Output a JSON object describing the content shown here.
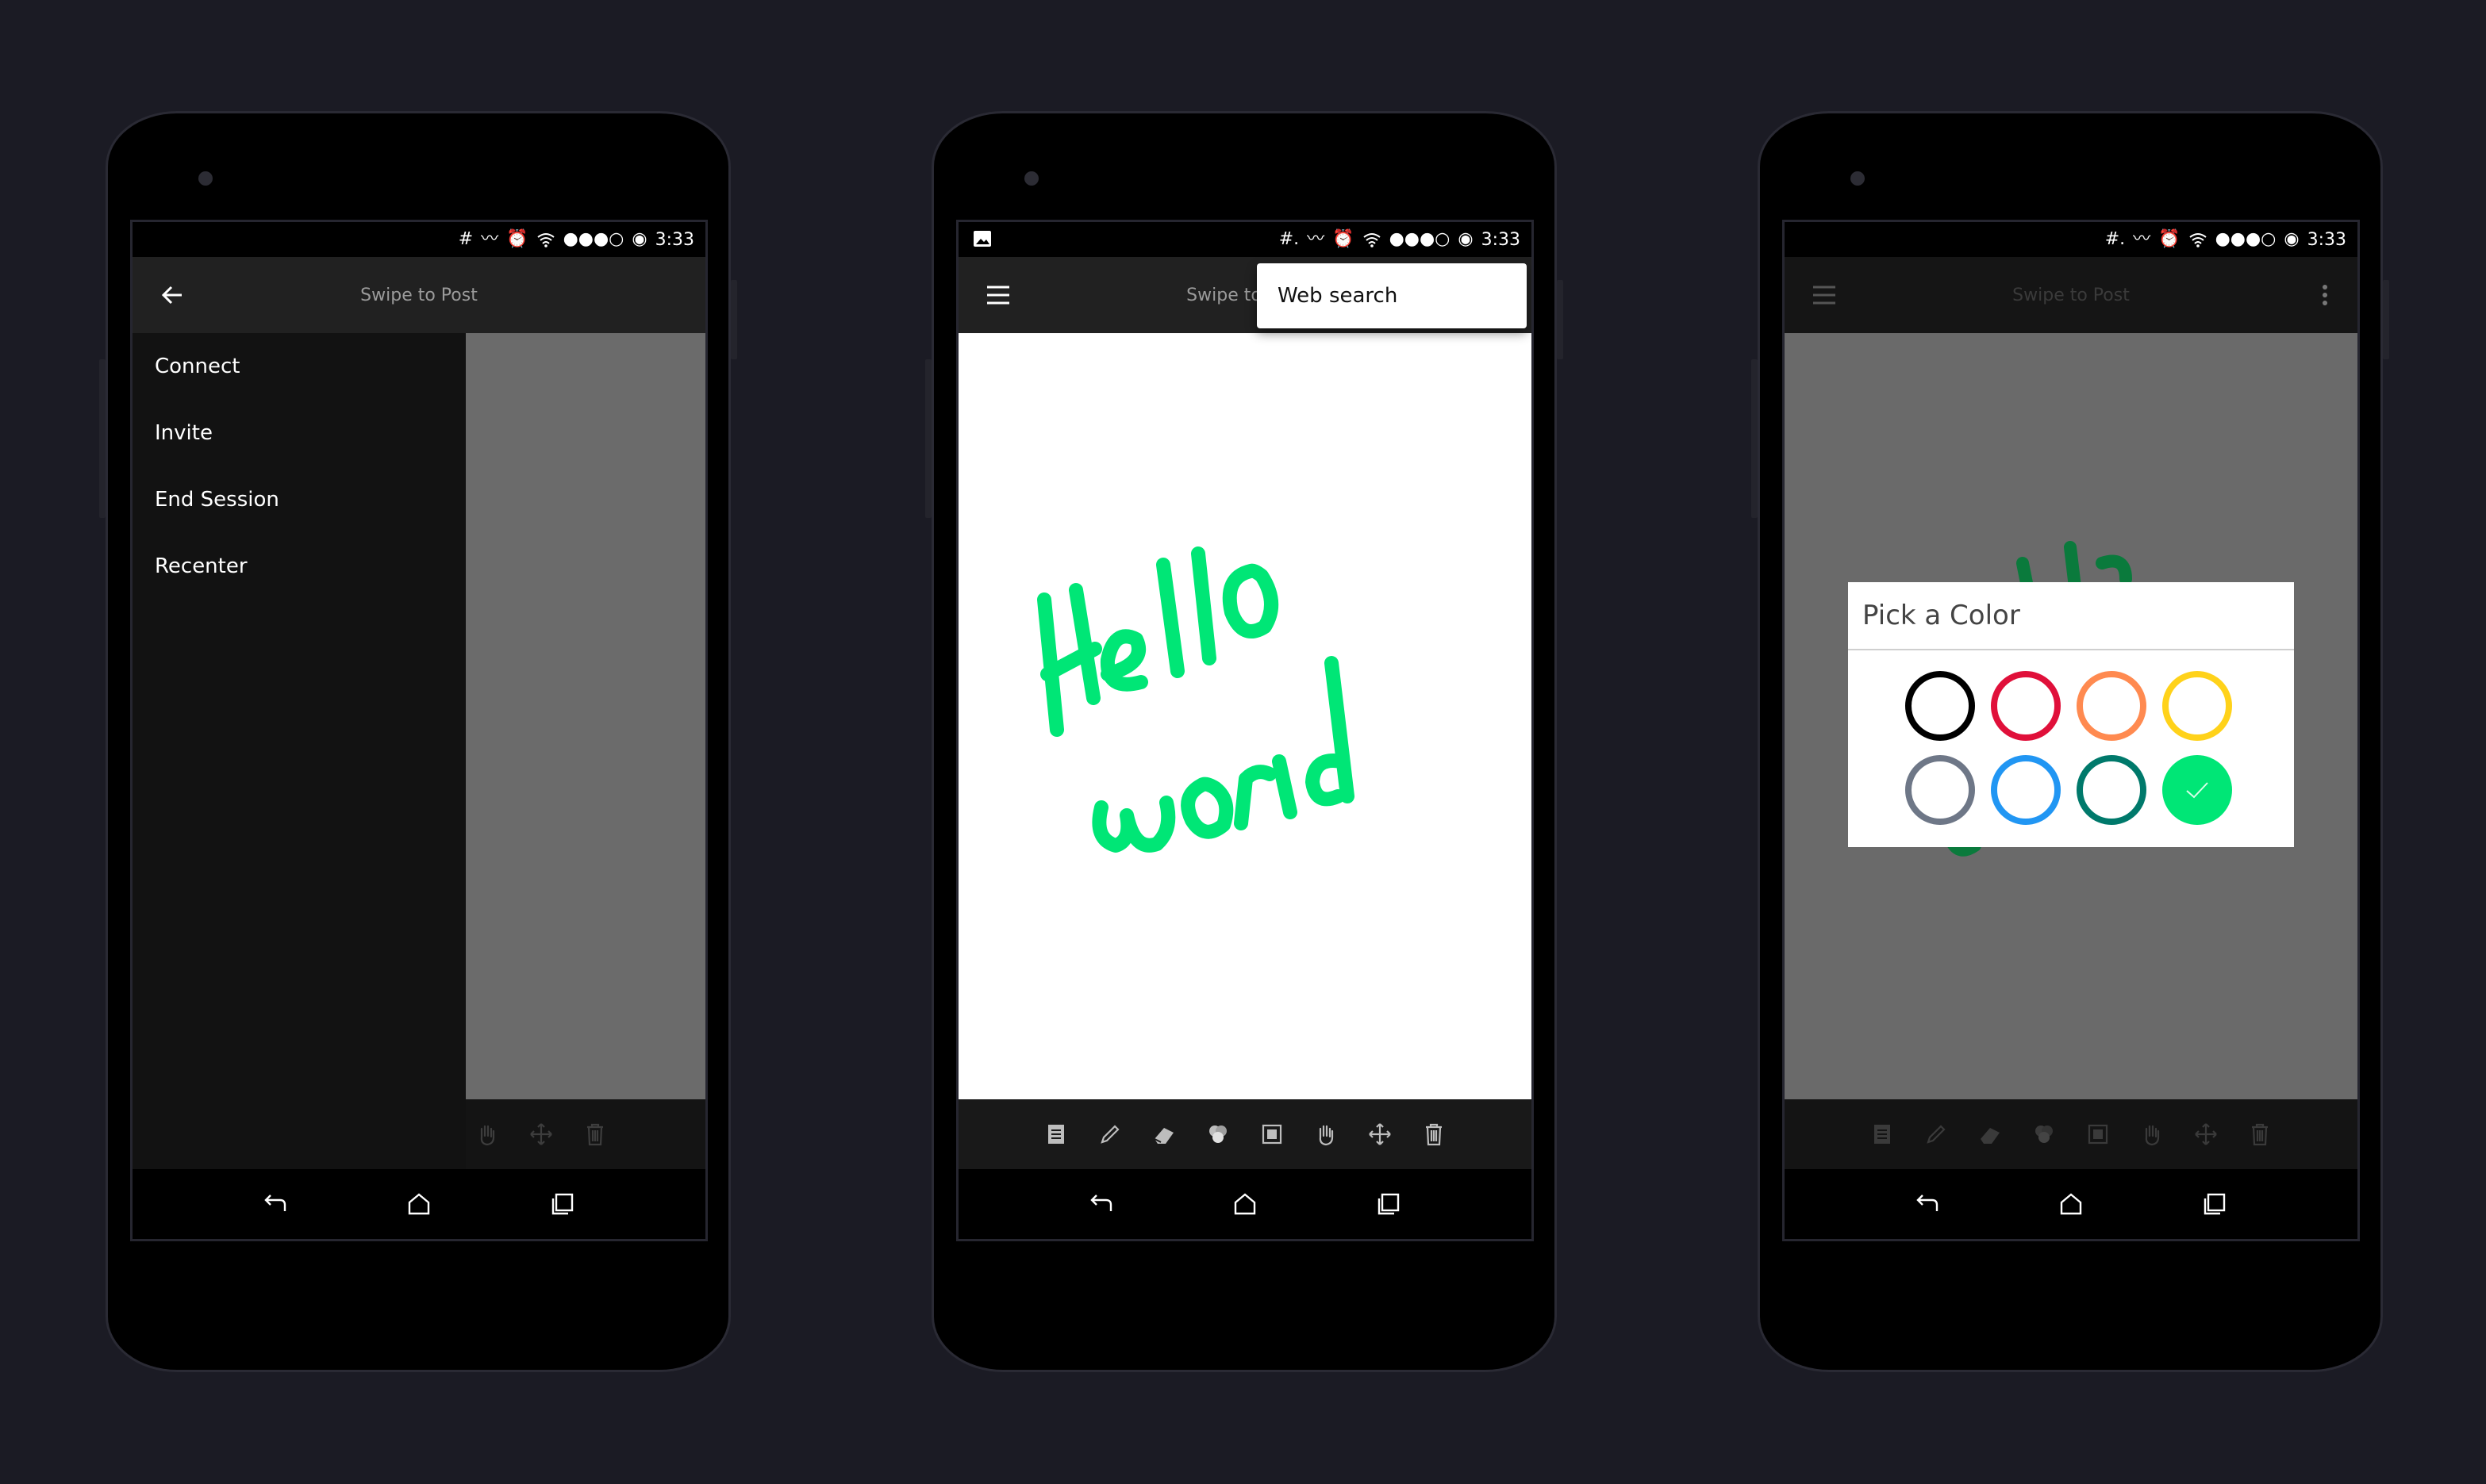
{
  "status_bar": {
    "time": "3:33",
    "hashtag": "#",
    "hashtag_alt": "#."
  },
  "app": {
    "title": "Swipe to Post"
  },
  "drawer": {
    "items": [
      "Connect",
      "Invite",
      "End Session",
      "Recenter"
    ]
  },
  "popup_menu": {
    "item": "Web search"
  },
  "canvas": {
    "handwriting_line1": "Hello",
    "handwriting_line2": "world",
    "ink_color": "#00e676"
  },
  "color_picker": {
    "title": "Pick a Color",
    "colors": [
      "#000000",
      "#e0103a",
      "#ff8a50",
      "#ffd21a",
      "#6e7787",
      "#2196f3",
      "#00796b",
      "#00e676"
    ],
    "selected_color": "#00e676"
  },
  "icons": {
    "toolbar": [
      "document-icon",
      "pencil-icon",
      "eraser-icon",
      "color-palette-icon",
      "layers-icon",
      "hand-icon",
      "move-icon",
      "trash-icon"
    ],
    "navigation": [
      "back-icon",
      "home-icon",
      "recents-icon"
    ]
  },
  "colors": {
    "background": "#1b1b24",
    "app_bar": "#212121",
    "accent": "#00e676"
  }
}
